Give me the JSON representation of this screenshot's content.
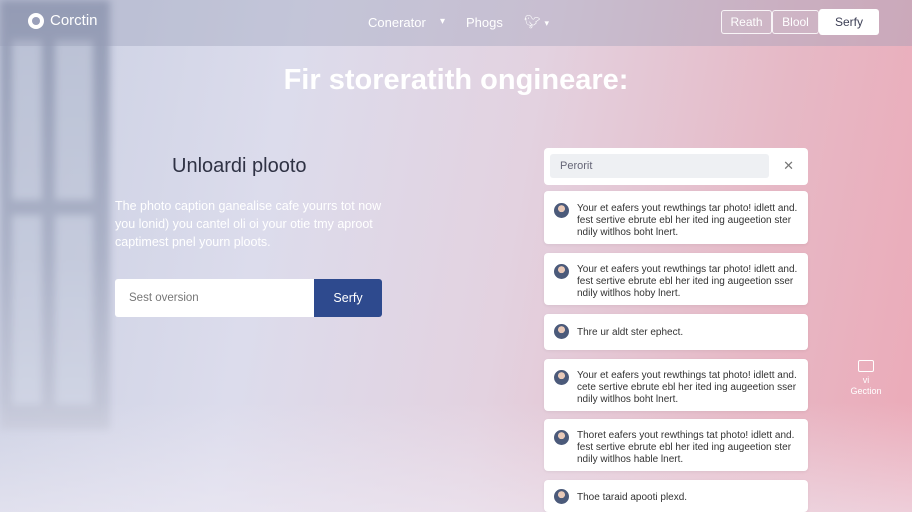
{
  "nav": {
    "brand": "Corctin",
    "links": [
      "Conerator",
      "Phogs"
    ],
    "buttons": {
      "outline1": "Reath",
      "outline2": "Blool",
      "solid": "Serfy"
    }
  },
  "hero": {
    "headline": "Fir storeratith ongineare:"
  },
  "upload": {
    "title": "Unloardi plooto",
    "description": "The photo caption ganealise cafe yourrs tot now you lonid) you cantel oli oi your otie tmy aproot captimest pnel yourn ploots.",
    "search_placeholder": "Sest oversion",
    "button": "Serfy"
  },
  "panel": {
    "search_text": "Perorit",
    "cards": [
      "Your et eafers yout rewthings tar photo! idlett and. fest sertive ebrute ebl her ited ing augeetion ster ndily witlhos boht lnert.",
      "Your et eafers yout rewthings tar photo! idlett and. fest sertive ebrute ebl her ited ing augeetion sser ndily witlhos hoby lnert.",
      "Thre ur aldt ster ephect.",
      "Your et eafers yout rewthings tat photo! idlett and. cete sertive ebrute ebl her ited ing augeetion sser ndily witlhos boht lnert.",
      "Thoret eafers yout rewthings tat photo! idlett and. fest sertive ebrute ebl her ited ing augeetion ster ndily witlhos hable lnert.",
      "Thoe taraid apooti plexd."
    ]
  },
  "side_widget": {
    "line1": "vi",
    "line2": "Gection"
  }
}
